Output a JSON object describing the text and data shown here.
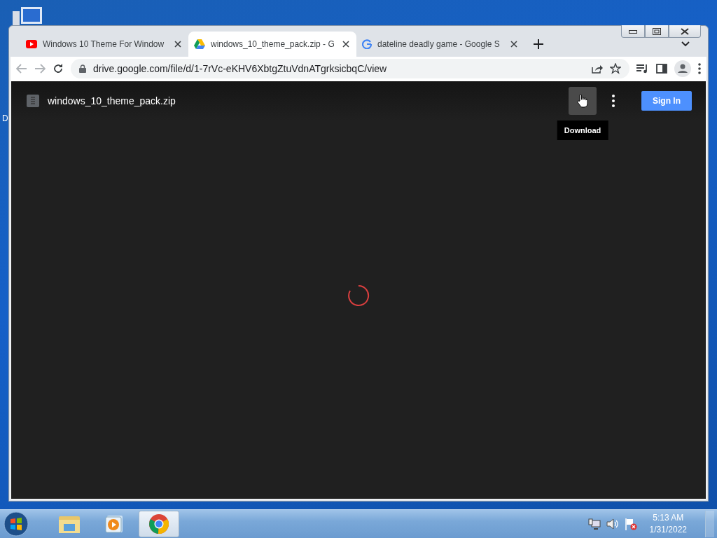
{
  "desktop": {
    "icon_label": "D"
  },
  "tabs": [
    {
      "kind": "youtube",
      "title": "Windows 10 Theme For Window",
      "selected": false
    },
    {
      "kind": "drive",
      "title": "windows_10_theme_pack.zip - G",
      "selected": true
    },
    {
      "kind": "google",
      "title": "dateline deadly game - Google S",
      "selected": false
    }
  ],
  "address_bar": {
    "url": "drive.google.com/file/d/1-7rVc-eKHV6XbtgZtuVdnATgrksicbqC/view"
  },
  "viewer": {
    "file_name": "windows_10_theme_pack.zip",
    "download_hovered": true,
    "tooltip": "Download",
    "sign_in": "Sign In"
  },
  "taskbar": {
    "apps": [
      {
        "kind": "explorer",
        "selected": false
      },
      {
        "kind": "media",
        "selected": false
      },
      {
        "kind": "chrome",
        "selected": true
      }
    ],
    "clock": {
      "time": "5:13 AM",
      "date": "1/31/2022"
    }
  }
}
